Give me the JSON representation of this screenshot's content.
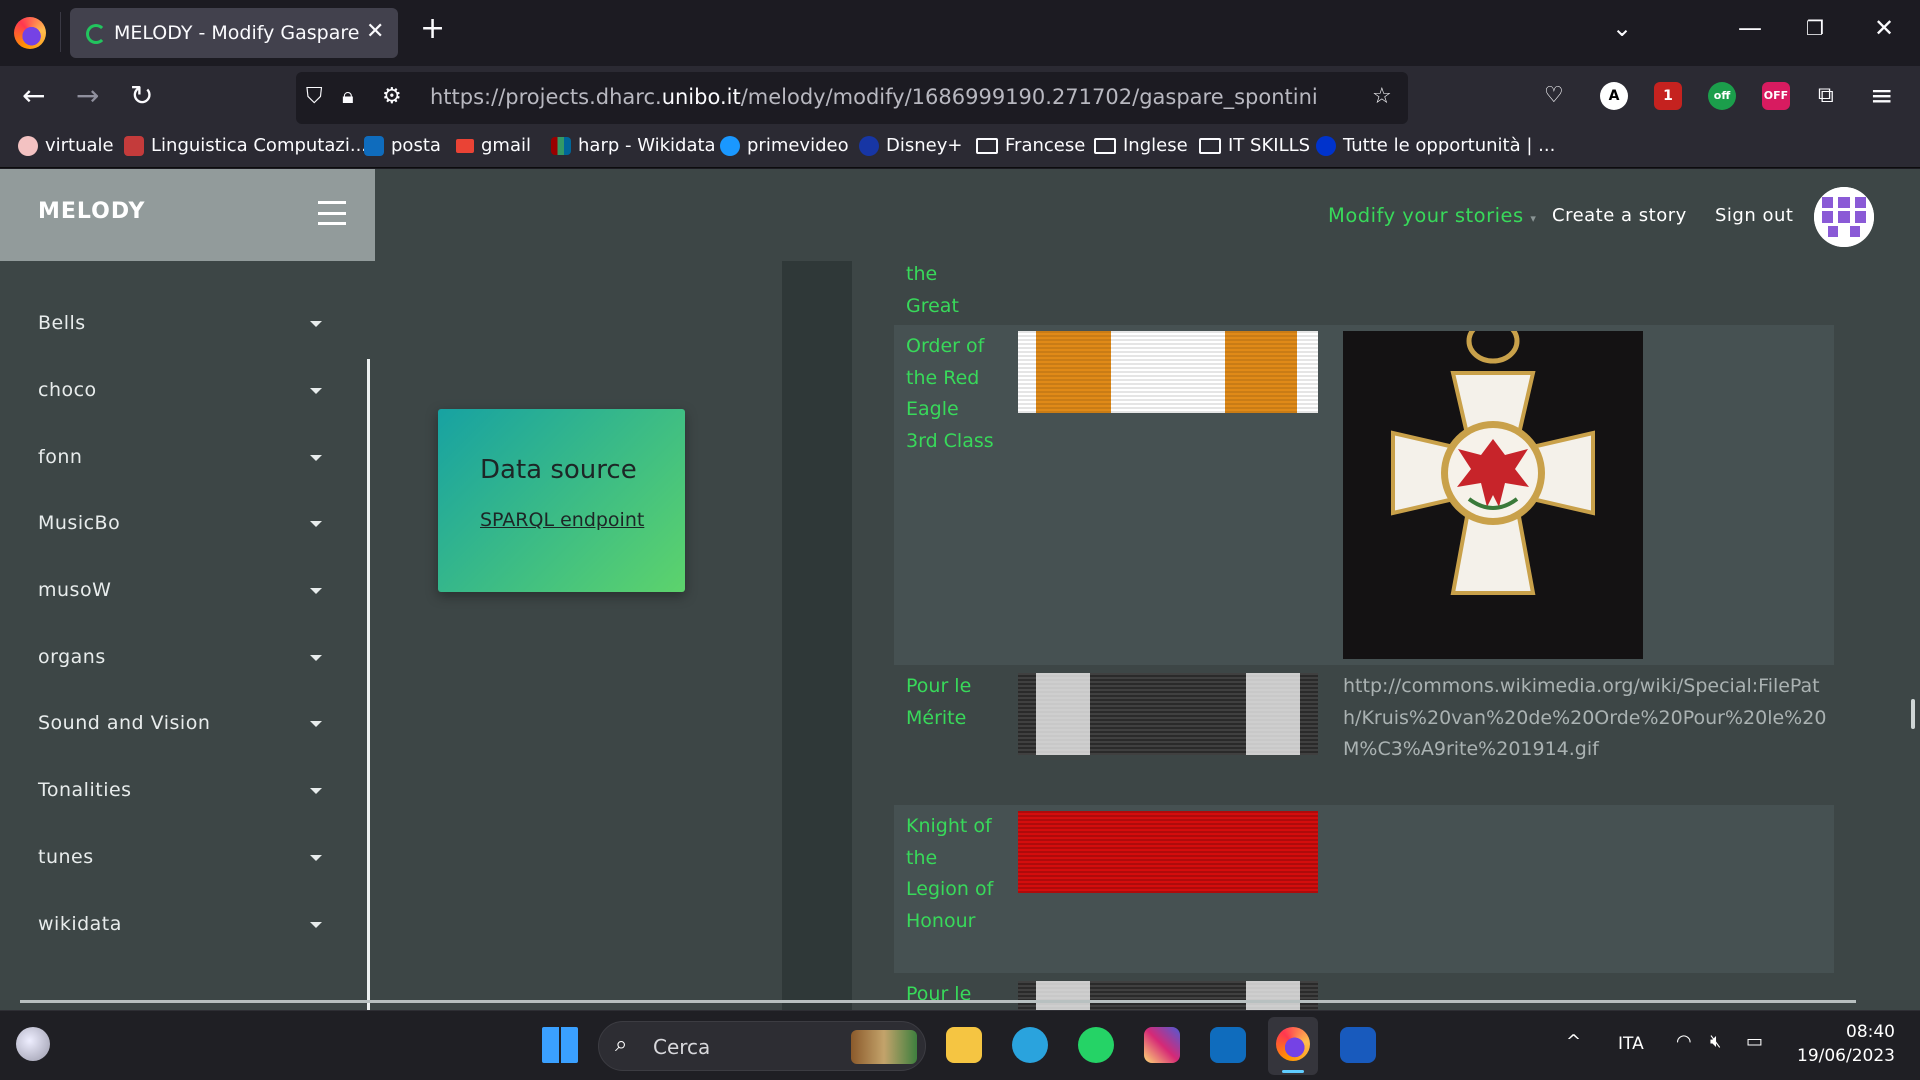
{
  "browser": {
    "tab_title": "MELODY - Modify Gaspare Spontini",
    "url_prefix": "https://projects.dharc.",
    "url_domain": "unibo.it",
    "url_path": "/melody/modify/1686999190.271702/gaspare_spontini",
    "new_tab": "+",
    "tab_close": "✕",
    "ext_badges": {
      "ublock": "1",
      "off1": "off",
      "off2": "OFF"
    },
    "bookmarks": [
      {
        "label": "virtuale",
        "color": "#f3c2c2"
      },
      {
        "label": "Linguistica Computazi...",
        "color": "#c43b3b"
      },
      {
        "label": "posta",
        "color": "#0f6cbd"
      },
      {
        "label": "gmail",
        "color": "#ea4335"
      },
      {
        "label": "harp - Wikidata",
        "color": "#990000"
      },
      {
        "label": "primevideo",
        "color": "#1a98ff"
      },
      {
        "label": "Disney+",
        "color": "#1736a5"
      },
      {
        "label": "Francese",
        "color": ""
      },
      {
        "label": "Inglese",
        "color": ""
      },
      {
        "label": "IT SKILLS",
        "color": ""
      },
      {
        "label": "Tutte le opportunità | ...",
        "color": "#0033cc"
      }
    ]
  },
  "app": {
    "brand": "MELODY",
    "nav": {
      "modify": "Modify your stories",
      "create": "Create a story",
      "signout": "Sign out"
    },
    "sidebar": [
      "Bells",
      "choco",
      "fonn",
      "MusicBo",
      "musoW",
      "organs",
      "Sound and Vision",
      "Tonalities",
      "tunes",
      "wikidata"
    ],
    "data_source": {
      "title": "Data source",
      "link": "SPARQL endpoint"
    },
    "table": {
      "rows": [
        {
          "label": "the Great",
          "ribbon": "",
          "image": ""
        },
        {
          "label": "Order of the Red Eagle 3rd Class",
          "ribbon": "red-eagle",
          "image": "medal"
        },
        {
          "label": "Pour le Mérite",
          "ribbon": "pour-le-merite",
          "image": "http://commons.wikimedia.org/wiki/Special:FilePath/Kruis%20van%20de%20Orde%20Pour%20le%20M%C3%A9rite%201914.gif"
        },
        {
          "label": "Knight of the Legion of Honour",
          "ribbon": "legion-honour",
          "image": ""
        },
        {
          "label": "Pour le",
          "ribbon": "pour-le-merite",
          "image": ""
        }
      ]
    },
    "colors": {
      "accent": "#38d95a",
      "bg": "#3d4646",
      "brand_bg": "#929b9b"
    }
  },
  "taskbar": {
    "search_placeholder": "Cerca",
    "lang": "ITA",
    "time": "08:40",
    "date": "19/06/2023"
  }
}
